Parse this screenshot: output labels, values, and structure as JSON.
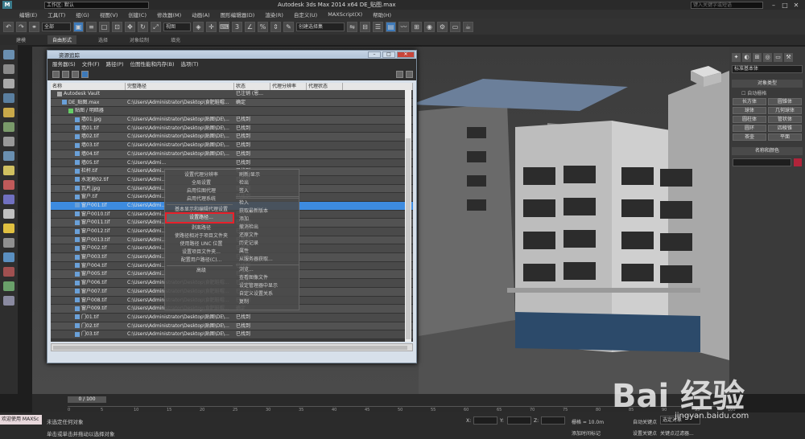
{
  "titlebar": {
    "workspace": "工作区: 默认",
    "title": "Autodesk 3ds Max  2014 x64     DE_贴图.max",
    "search_placeholder": "键入关键字或短语"
  },
  "menubar": [
    "编辑(E)",
    "工具(T)",
    "组(G)",
    "视图(V)",
    "创建(C)",
    "修改器(M)",
    "动画(A)",
    "图形编辑器(D)",
    "渲染(R)",
    "自定义(U)",
    "MAXScript(X)",
    "帮助(H)"
  ],
  "toolbar": {
    "filter": "全部",
    "view": "视图",
    "selection_set": "创建选择集"
  },
  "ribbon": {
    "tabs": [
      "建模",
      "自由形式",
      "选择",
      "对象绘制",
      "填充"
    ],
    "selected": "自由形式"
  },
  "dialog": {
    "title": "资源追踪",
    "menu": [
      "服务器(S)",
      "文件(F)",
      "路径(P)",
      "位图性能和内存(B)",
      "选项(T)"
    ],
    "columns": [
      "名称",
      "完整路径",
      "状态",
      "代理分辨率",
      "代理状态"
    ],
    "rows": [
      {
        "name": "Autodesk Vault",
        "path": "",
        "status": "已注销 (恩...",
        "icon": "v"
      },
      {
        "name": "DE_贴图.max",
        "path": "C:\\Users\\Administrator\\Desktop\\食肥鞋帽...",
        "status": "确定",
        "icon": "b"
      },
      {
        "name": "贴图 / 明暗器",
        "path": "",
        "status": "",
        "icon": "g"
      },
      {
        "name": "墙01.jpg",
        "path": "C:\\Users\\Administrator\\Desktop\\贴图\\DE\\...",
        "status": "已找到",
        "icon": "b"
      },
      {
        "name": "墙01.tif",
        "path": "C:\\Users\\Administrator\\Desktop\\贴图\\DE\\...",
        "status": "已找到",
        "icon": "b"
      },
      {
        "name": "墙02.tif",
        "path": "C:\\Users\\Administrator\\Desktop\\贴图\\DE\\...",
        "status": "已找到",
        "icon": "b"
      },
      {
        "name": "墙03.tif",
        "path": "C:\\Users\\Administrator\\Desktop\\贴图\\DE\\...",
        "status": "已找到",
        "icon": "b"
      },
      {
        "name": "墙04.tif",
        "path": "C:\\Users\\Administrator\\Desktop\\贴图\\DE\\...",
        "status": "已找到",
        "icon": "b"
      },
      {
        "name": "墙05.tif",
        "path": "C:\\Users\\Admi...",
        "status": "已找到",
        "icon": "b"
      },
      {
        "name": "栏杆.tif",
        "path": "C:\\Users\\Admi...",
        "status": "已找到",
        "icon": "b"
      },
      {
        "name": "水泥地02.tif",
        "path": "C:\\Users\\Admi...",
        "status": "已找到",
        "icon": "b"
      },
      {
        "name": "瓦片.jpg",
        "path": "C:\\Users\\Admi...",
        "status": "已找到",
        "icon": "b"
      },
      {
        "name": "窗户.tif",
        "path": "C:\\Users\\Admi...",
        "status": "已找到",
        "icon": "b"
      },
      {
        "name": "窗户001.tif",
        "path": "C:\\Users\\Admi...",
        "status": "",
        "icon": "b",
        "selected": true
      },
      {
        "name": "窗户0010.tif",
        "path": "C:\\Users\\Admi...",
        "status": "已找到",
        "icon": "b"
      },
      {
        "name": "窗户0011.tif",
        "path": "C:\\Users\\Admi...",
        "status": "已找到",
        "icon": "b"
      },
      {
        "name": "窗户0012.tif",
        "path": "C:\\Users\\Admi...",
        "status": "已找到",
        "icon": "b"
      },
      {
        "name": "窗户0013.tif",
        "path": "C:\\Users\\Admi...",
        "status": "已找到",
        "icon": "b"
      },
      {
        "name": "窗户002.tif",
        "path": "C:\\Users\\Admi...",
        "status": "已找到",
        "icon": "b"
      },
      {
        "name": "窗户003.tif",
        "path": "C:\\Users\\Admi...",
        "status": "已找到",
        "icon": "b"
      },
      {
        "name": "窗户004.tif",
        "path": "C:\\Users\\Admi...",
        "status": "已找到",
        "icon": "b"
      },
      {
        "name": "窗户005.tif",
        "path": "C:\\Users\\Admi...",
        "status": "已找到",
        "icon": "b"
      },
      {
        "name": "窗户006.tif",
        "path": "C:\\Users\\Administrator\\Desktop\\食肥鞋帽...",
        "status": "已找到",
        "icon": "b"
      },
      {
        "name": "窗户007.tif",
        "path": "C:\\Users\\Administrator\\Desktop\\食肥鞋帽...",
        "status": "已找到",
        "icon": "b"
      },
      {
        "name": "窗户008.tif",
        "path": "C:\\Users\\Administrator\\Desktop\\食肥鞋帽...",
        "status": "已找到",
        "icon": "b"
      },
      {
        "name": "窗户009.tif",
        "path": "C:\\Users\\Administrator\\Desktop\\食肥鞋帽...",
        "status": "确定",
        "icon": "b"
      },
      {
        "name": "门01.tif",
        "path": "C:\\Users\\Administrator\\Desktop\\贴图\\DE\\...",
        "status": "已找到",
        "icon": "b"
      },
      {
        "name": "门02.tif",
        "path": "C:\\Users\\Administrator\\Desktop\\贴图\\DE\\...",
        "status": "已找到",
        "icon": "b"
      },
      {
        "name": "门03.tif",
        "path": "C:\\Users\\Administrator\\Desktop\\贴图\\DE\\...",
        "status": "已找到",
        "icon": "b"
      }
    ]
  },
  "context_menu": {
    "left": [
      "设置代理分辨率",
      "全局设置",
      "启用位图代理",
      "启用代理系统",
      "",
      "基本显示和编辑代理设置",
      "设置路径...",
      "",
      "剥离路径",
      "使路径相对于项目文件夹",
      "使用路径 UNC 位置",
      "设置项目文件夹...",
      "配置用户路径(C)...",
      "",
      "高级"
    ],
    "right": [
      "刷新/显示",
      "检出",
      "签入",
      "",
      "",
      "检入",
      "获取最新版本",
      "添加",
      "撤消检出",
      "还原文件",
      "历史记录",
      "属性",
      "从服务器获取...",
      "",
      "浏览...",
      "查看图像文件",
      "设定管理器中显示",
      "自定义设置关系",
      "复制"
    ],
    "highlighted": "设置路径..."
  },
  "right_panel": {
    "combo": "标准基本体",
    "section": "对象类型",
    "autogrid": "自动栅格",
    "objects": [
      "长方体",
      "圆锥体",
      "球体",
      "几何球体",
      "圆柱体",
      "管状体",
      "圆环",
      "四棱锥",
      "茶壶",
      "平面"
    ],
    "name_color": "名称和颜色"
  },
  "timeline": {
    "frame": "0 / 100",
    "ticks": [
      "0",
      "5",
      "10",
      "15",
      "20",
      "25",
      "30",
      "35",
      "40",
      "45",
      "50",
      "55",
      "60",
      "65",
      "70",
      "75",
      "80",
      "85",
      "90",
      "95",
      "100"
    ]
  },
  "status": {
    "welcome": "欢迎使用 MAXSc",
    "line1": "未选定任何对象",
    "line2": "单击或单击并拖动以选择对象",
    "x_label": "X:",
    "y_label": "Y:",
    "z_label": "Z:",
    "grid": "栅格 = 10.0m",
    "autokey": "自动关键点",
    "keymode": "选定对象",
    "setkey": "设置关键点",
    "keyfilter": "关键点过滤器...",
    "addtime": "添加时间标记"
  },
  "watermark": {
    "brand": "Bai 经验",
    "url": "jingyan.baidu.com"
  }
}
